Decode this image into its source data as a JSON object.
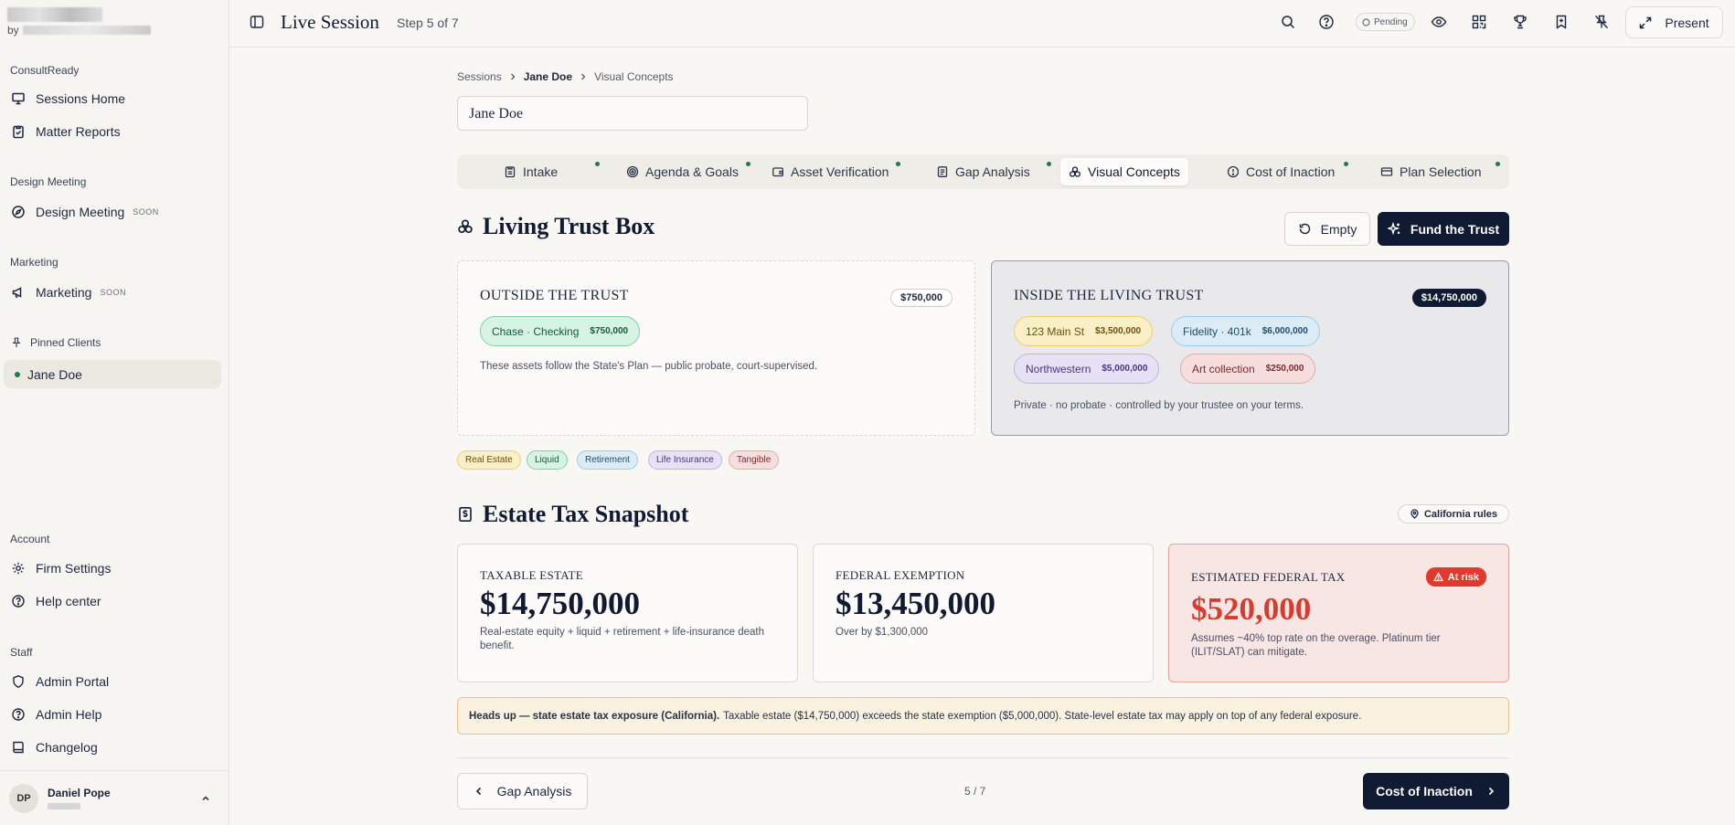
{
  "sidebar": {
    "by": "by",
    "sections": {
      "consultready": "ConsultReady",
      "design_meeting": "Design Meeting",
      "marketing": "Marketing",
      "pinned": "Pinned Clients",
      "account": "Account",
      "staff": "Staff"
    },
    "items": {
      "sessions_home": "Sessions Home",
      "matter_reports": "Matter Reports",
      "design_meeting": "Design Meeting",
      "design_meeting_badge": "SOON",
      "marketing": "Marketing",
      "marketing_badge": "SOON",
      "jane_doe": "Jane Doe",
      "firm_settings": "Firm Settings",
      "help_center": "Help center",
      "admin_portal": "Admin Portal",
      "admin_help": "Admin Help",
      "changelog": "Changelog"
    },
    "user": {
      "initials": "DP",
      "name": "Daniel Pope"
    }
  },
  "topbar": {
    "title": "Live Session",
    "step": "Step 5 of 7",
    "status": "Pending",
    "present_label": "Present"
  },
  "breadcrumb": {
    "root": "Sessions",
    "client": "Jane Doe",
    "current": "Visual Concepts"
  },
  "client_input": {
    "value": "Jane Doe"
  },
  "tabs": [
    {
      "label": "Intake"
    },
    {
      "label": "Agenda & Goals"
    },
    {
      "label": "Asset Verification"
    },
    {
      "label": "Gap Analysis"
    },
    {
      "label": "Visual Concepts"
    },
    {
      "label": "Cost of Inaction"
    },
    {
      "label": "Plan Selection"
    }
  ],
  "trust_box": {
    "title": "Living Trust Box",
    "empty_label": "Empty",
    "fund_label": "Fund the Trust",
    "outside": {
      "title": "OUTSIDE THE TRUST",
      "total": "$750,000",
      "assets": [
        {
          "name": "Chase · Checking",
          "amount": "$750,000",
          "color": "#d6f3e4"
        }
      ],
      "note": "These assets follow the State's Plan — public probate, court-supervised."
    },
    "inside": {
      "title": "INSIDE THE LIVING TRUST",
      "total": "$14,750,000",
      "assets": [
        {
          "name": "123 Main St",
          "amount": "$3,500,000",
          "color": "#fbefc7"
        },
        {
          "name": "Fidelity · 401k",
          "amount": "$6,000,000",
          "color": "#dcecf7"
        },
        {
          "name": "Northwestern",
          "amount": "$5,000,000",
          "color": "#e7e1f5"
        },
        {
          "name": "Art collection",
          "amount": "$250,000",
          "color": "#f6dede"
        }
      ],
      "note": "Private · no probate · controlled by your trustee on your terms."
    },
    "legend": [
      "Real Estate",
      "Liquid",
      "Retirement",
      "Life Insurance",
      "Tangible"
    ]
  },
  "estate_tax": {
    "title": "Estate Tax Snapshot",
    "rules_label": "California rules",
    "cards": [
      {
        "label": "TAXABLE ESTATE",
        "value": "$14,750,000",
        "note": "Real-estate equity + liquid + retirement + life-insurance death benefit."
      },
      {
        "label": "FEDERAL EXEMPTION",
        "value": "$13,450,000",
        "note": "Over by $1,300,000"
      },
      {
        "label": "ESTIMATED FEDERAL TAX",
        "value": "$520,000",
        "badge": "At risk",
        "note": "Assumes ~40% top rate on the overage. Platinum tier (ILIT/SLAT) can mitigate."
      }
    ],
    "headsup_strong": "Heads up — state estate tax exposure (California).",
    "headsup_text": "Taxable estate ($14,750,000) exceeds the state exemption ($5,000,000). State-level estate tax may apply on top of any federal exposure."
  },
  "footer_nav": {
    "prev_label": "Gap Analysis",
    "page": "5 / 7",
    "next_label": "Cost of Inaction"
  }
}
